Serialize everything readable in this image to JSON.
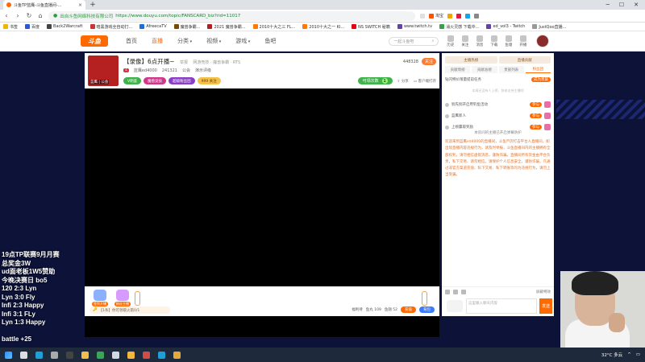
{
  "browser": {
    "tab_title": "斗鱼TP蓝鹰-斗鱼直播间-...",
    "url_secure_text": "出自斗鱼网络科技有限公司",
    "url_address": "https://www.douyu.com/topic/FANSCARD_biz?rid=11017",
    "extensions": [
      {
        "label": "",
        "color": "#e0e0e0"
      },
      {
        "label": "淘宝",
        "color": "#ff5000"
      },
      {
        "label": "",
        "color": "#f5a300"
      },
      {
        "label": "",
        "color": "#e21c3e"
      },
      {
        "label": "",
        "color": "#1ba3e8"
      },
      {
        "label": "",
        "color": "#888"
      }
    ],
    "bookmarks": [
      {
        "label": "书签",
        "color": "#f3b400"
      },
      {
        "label": "百度",
        "color": "#2b57d6"
      },
      {
        "label": "Back2Warcraft",
        "color": "#444"
      },
      {
        "label": "暗黑游戏全自动打...",
        "color": "#c33"
      },
      {
        "label": "AfreecaTV",
        "color": "#1a6ede"
      },
      {
        "label": "魔兽争霸...",
        "color": "#7a4a00"
      },
      {
        "label": "2021 魔兽争霸...",
        "color": "#b02020"
      },
      {
        "label": "2010十大之三 FL...",
        "color": "#ff7a00"
      },
      {
        "label": "2010十大之一 KI...",
        "color": "#ff7a00"
      },
      {
        "label": "NS SWITCH 秘籍",
        "color": "#e60012"
      },
      {
        "label": "www.twitch.tv",
        "color": "#6441a5"
      },
      {
        "label": "消火灵感 下载中...",
        "color": "#3a9f4a"
      },
      {
        "label": "ed_vol3 - Twitch",
        "color": "#6441a5"
      },
      {
        "label": "JustQoo直播...",
        "color": "#999"
      }
    ]
  },
  "site": {
    "logo": "斗鱼",
    "nav": [
      "首页",
      "直播",
      "分类",
      "视频",
      "游戏",
      "鱼吧"
    ],
    "search_placeholder": "一起斗鱼吧",
    "header_icons": [
      "历史",
      "关注",
      "消息",
      "下载",
      "鱼塘",
      "开播"
    ]
  },
  "room": {
    "title": "【录像】6点开播~",
    "rep_label": "举报",
    "category": "网游竞技 · 魔兽争霸 · RTS",
    "level_badge": "1",
    "anchor_name": "蓝鹰ed4000",
    "room_id": "241321",
    "viewers": "公会",
    "rank": "演示评级",
    "avatar_label": "蓝鹰 | 公会",
    "followers": "448328",
    "follow_label": "关注",
    "badges": [
      {
        "label": "V明鉴",
        "style": "rb-green"
      },
      {
        "label": "魔兽竞技",
        "style": "rb-pink"
      },
      {
        "label": "超级粉丝团",
        "style": "rb-purple"
      },
      {
        "label": "999 关注",
        "style": "rb-yellow"
      }
    ],
    "tasks_label": "可领次数",
    "tasks_count": "1",
    "share_label": "分享",
    "client_label": "客户端打开"
  },
  "giftbar": {
    "gifts": [
      {
        "label": "签到开播",
        "color": "#8ab0ff"
      },
      {
        "label": "粉丝主播",
        "color": "#d79bff"
      }
    ],
    "task_text": "【1条】你可领取火箭0/1",
    "right_items": [
      "福利待",
      "鱼丸 109",
      "鱼翅 52"
    ],
    "charge_label": "充值",
    "backpack_label": "背包"
  },
  "rightpanel": {
    "tabs_top": [
      "主播热榜",
      "直播贡献"
    ],
    "tabs": [
      "贡献周榜",
      "贡献总榜",
      "贵族列表",
      "粉丝团"
    ],
    "rank_title": "钻闪特价限量提前任务",
    "rank_btn": "成为贵族",
    "empty_text": "本周还没有人上榜，快来支持主播吧",
    "rows": [
      {
        "label": "别先别开启用钓鱼活动"
      },
      {
        "label": "蓝鹰新人"
      },
      {
        "label": "上榜赢取奖励"
      }
    ],
    "notice": "本房间的主播已开启弹幕防护",
    "description": "欢迎来到蓝鹰ed4000的直播间，斗鱼严厉打击平台人直播间，如出现直播内容违规行为，请及时举报，斗鱼直播间内的主播拥有全部权利，请勿相信虚假消息，谨防诈骗。直播间所有资金由平台负责，私下交易、请勿相信。请保护个人信息安全，谨防诈骗，凡通过非官方渠道充值、私下交易、私下转账等均为违规行为，请勿上当受骗。",
    "block_label": "屏蔽特效",
    "input_placeholder": "这里输入聊天内容",
    "send_label": "发送"
  },
  "overlay_lines": [
    "19点TP联赛9月月赛",
    "总奖金3W",
    "ud面老板1W5赞助",
    "今晚决赛日 bo5",
    "120 2:3 Lyn",
    "Lyn 3:0 Fly",
    "Infi 2:3 Happy",
    "Infi 3:1 FLy",
    "Lyn 1:3 Happy",
    "",
    "battle +25"
  ],
  "taskbar": {
    "time": "32°C 多云",
    "icons": [
      {
        "name": "windows-start",
        "color": "#2f8cff"
      },
      {
        "name": "search",
        "color": "#ddd"
      },
      {
        "name": "edge",
        "color": "#1f9fd9"
      },
      {
        "name": "settings",
        "color": "#aaa"
      },
      {
        "name": "obs",
        "color": "#444"
      },
      {
        "name": "explorer",
        "color": "#f0c04a"
      },
      {
        "name": "chrome",
        "color": "#3aa757"
      },
      {
        "name": "cursor",
        "color": "#cfd8e3"
      },
      {
        "name": "folder",
        "color": "#f4b73d"
      },
      {
        "name": "app",
        "color": "#d24b4b"
      },
      {
        "name": "edge2",
        "color": "#1f9fd9"
      },
      {
        "name": "game",
        "color": "#e3a93b"
      }
    ]
  }
}
